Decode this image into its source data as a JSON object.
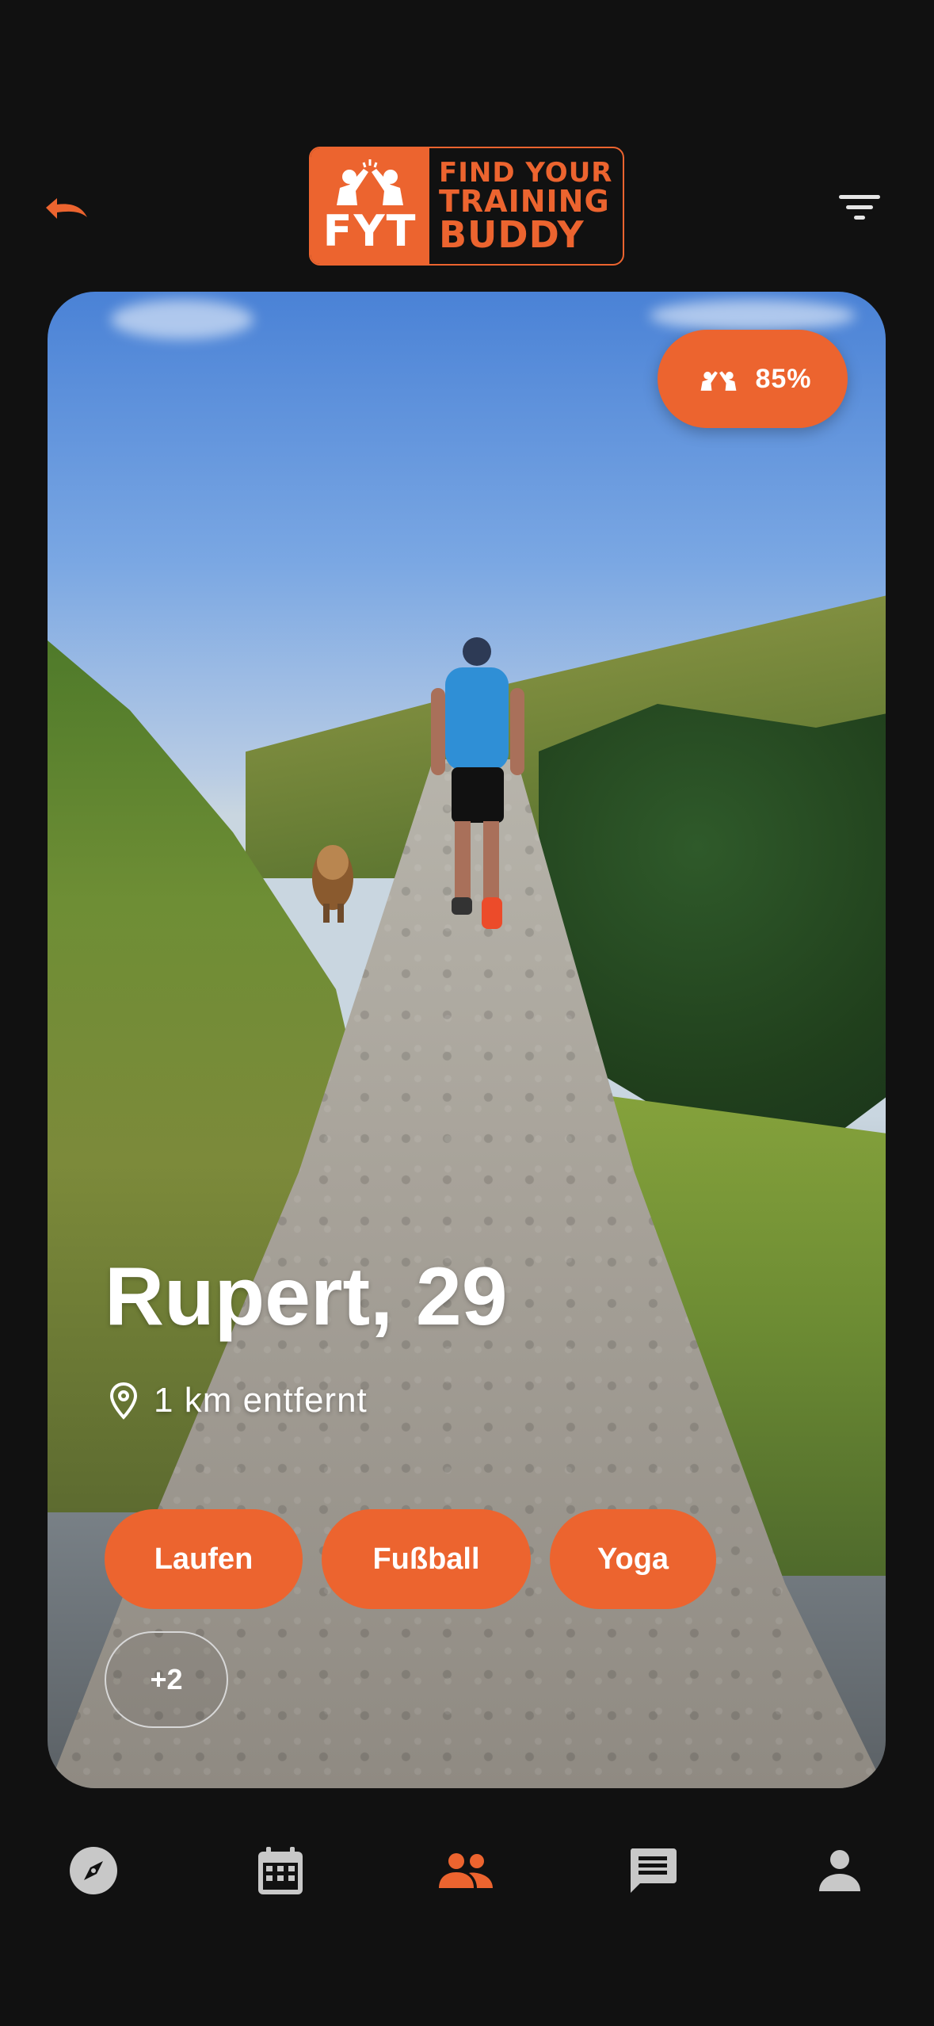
{
  "header": {
    "back_icon": "undo-arrow-icon",
    "filter_icon": "filter-icon",
    "logo": {
      "mark": "FYT",
      "line1": "FIND YOUR",
      "line2": "TRAINING",
      "line3": "BUDDY"
    }
  },
  "profile": {
    "match_percent": "85%",
    "name_age": "Rupert, 29",
    "distance": "1  km entfernt",
    "sports": [
      "Laufen",
      "Fußball",
      "Yoga"
    ],
    "more": "+2"
  },
  "nav": {
    "items": [
      {
        "icon": "compass-icon",
        "active": false
      },
      {
        "icon": "calendar-icon",
        "active": false
      },
      {
        "icon": "people-icon",
        "active": true
      },
      {
        "icon": "chat-icon",
        "active": false
      },
      {
        "icon": "person-icon",
        "active": false
      }
    ]
  },
  "colors": {
    "accent": "#ec642f",
    "background": "#111111",
    "nav_inactive": "#c8c8c8"
  }
}
